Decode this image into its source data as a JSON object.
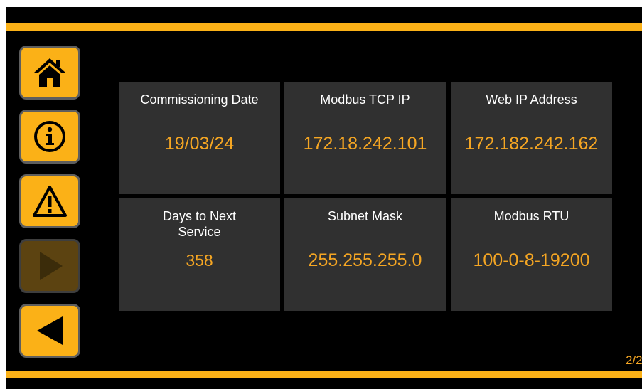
{
  "nav": {
    "home_icon": "home-icon",
    "info_icon": "info-icon",
    "alarm_icon": "warning-icon",
    "forward_icon": "play-icon",
    "back_icon": "back-arrow-icon"
  },
  "tiles": [
    {
      "label": "Commissioning Date",
      "value": "19/03/24"
    },
    {
      "label": "Modbus TCP IP",
      "value": "172.18.242.101"
    },
    {
      "label": "Web IP Address",
      "value": "172.182.242.162"
    },
    {
      "label": "Days to Next Service",
      "value": "358"
    },
    {
      "label": "Subnet Mask",
      "value": "255.255.255.0"
    },
    {
      "label": "Modbus RTU",
      "value": "100-0-8-19200"
    }
  ],
  "page_indicator": "2/2",
  "colors": {
    "accent": "#fbb117",
    "value_text": "#f5a623",
    "tile_bg": "#303030",
    "background": "#000000"
  }
}
